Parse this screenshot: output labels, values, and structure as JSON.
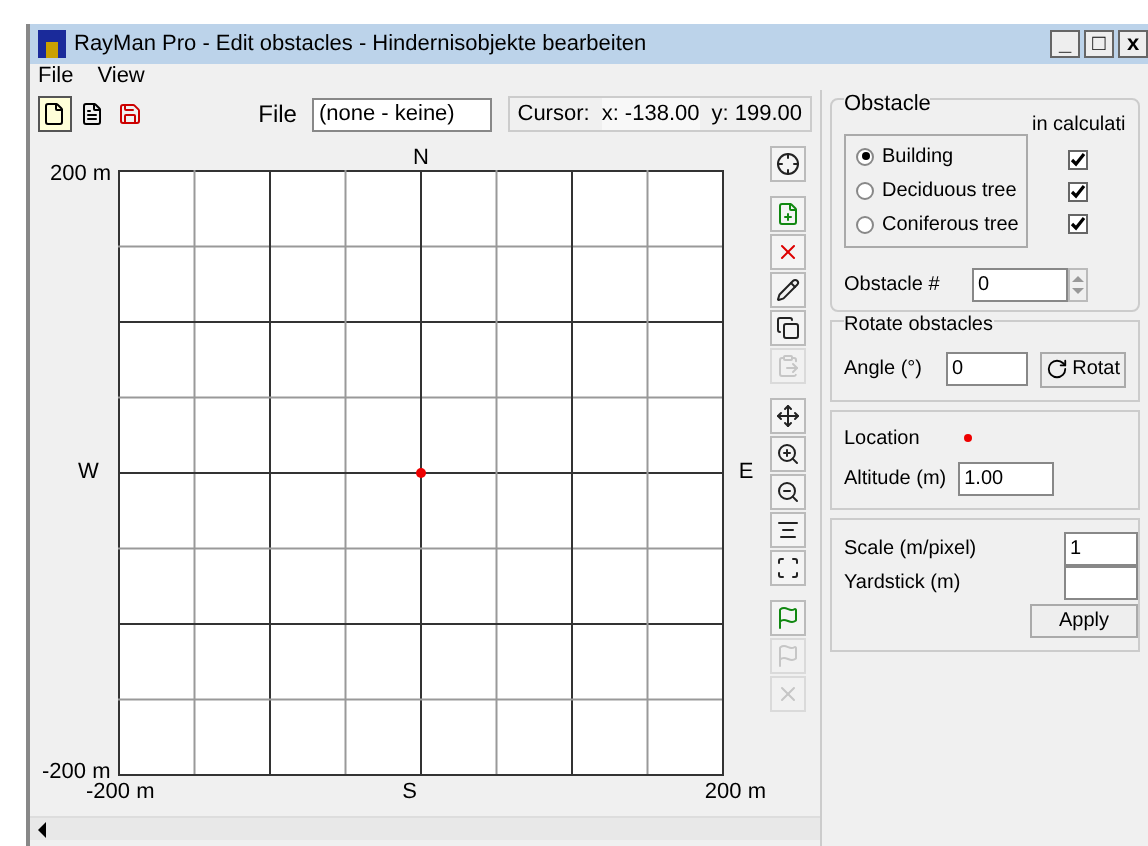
{
  "window": {
    "title": "RayMan Pro - Edit obstacles - Hindernisobjekte bearbeiten",
    "controls": [
      "_",
      "□",
      "x"
    ]
  },
  "menu": [
    "File",
    "View"
  ],
  "toolbar": {
    "file_label": "File",
    "file_value": "(none - keine)",
    "cursor_label": "Cursor:",
    "cursor_x": "x: -138.00",
    "cursor_y": "y: 199.00"
  },
  "map": {
    "north": "N",
    "south": "S",
    "west": "W",
    "east": "E",
    "y_top": "200 m",
    "y_bottom": "-200 m",
    "x_left": "-200 m",
    "x_right": "200 m"
  },
  "tools": [
    {
      "kind": "center",
      "disabled": false
    },
    {
      "kind": "add",
      "disabled": false
    },
    {
      "kind": "delete",
      "disabled": false
    },
    {
      "kind": "edit",
      "disabled": false
    },
    {
      "kind": "copy",
      "disabled": false
    },
    {
      "kind": "paste",
      "disabled": true
    },
    {
      "kind": "move",
      "disabled": false
    },
    {
      "kind": "zoom-in",
      "disabled": false
    },
    {
      "kind": "zoom-out",
      "disabled": false
    },
    {
      "kind": "level",
      "disabled": false
    },
    {
      "kind": "fit",
      "disabled": false
    },
    {
      "kind": "flag",
      "disabled": false
    },
    {
      "kind": "flag",
      "disabled": true
    },
    {
      "kind": "clear",
      "disabled": true
    }
  ],
  "obstacle": {
    "title": "Obstacle",
    "in_calc": "in calculati",
    "types": [
      {
        "label": "Building",
        "selected": true,
        "checked": true
      },
      {
        "label": "Deciduous tree",
        "selected": false,
        "checked": true
      },
      {
        "label": "Coniferous tree",
        "selected": false,
        "checked": true
      }
    ],
    "number_label": "Obstacle #",
    "number_value": "0"
  },
  "rotate": {
    "title": "Rotate obstacles",
    "angle_label": "Angle (°)",
    "angle_value": "0",
    "button": "Rotat"
  },
  "location": {
    "label": "Location",
    "altitude_label": "Altitude (m)",
    "altitude_value": "1.00"
  },
  "scale": {
    "scale_label": "Scale (m/pixel)",
    "scale_value": "1",
    "yardstick_label": "Yardstick (m)",
    "button": "Apply"
  }
}
